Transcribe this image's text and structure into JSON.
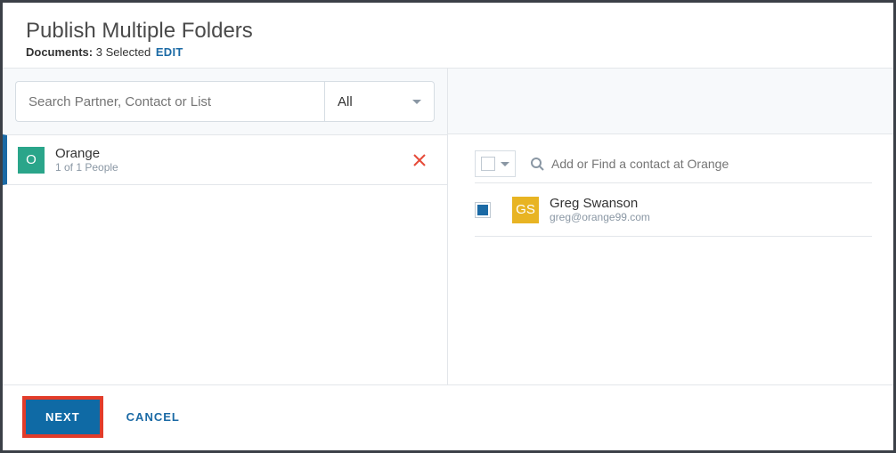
{
  "header": {
    "title": "Publish Multiple Folders",
    "documents_label": "Documents:",
    "selected_text": "3 Selected",
    "edit_label": "EDIT"
  },
  "search": {
    "placeholder": "Search Partner, Contact or List",
    "filter_value": "All"
  },
  "selected_partners": [
    {
      "avatar_color": "green",
      "initial": "O",
      "name": "Orange",
      "meta": "1 of 1 People"
    }
  ],
  "contacts_panel": {
    "find_placeholder": "Add or Find a contact at Orange",
    "contacts": [
      {
        "checked": true,
        "avatar_color": "gold",
        "initials": "GS",
        "name": "Greg Swanson",
        "email": "greg@orange99.com"
      }
    ]
  },
  "footer": {
    "next_label": "NEXT",
    "cancel_label": "CANCEL"
  }
}
